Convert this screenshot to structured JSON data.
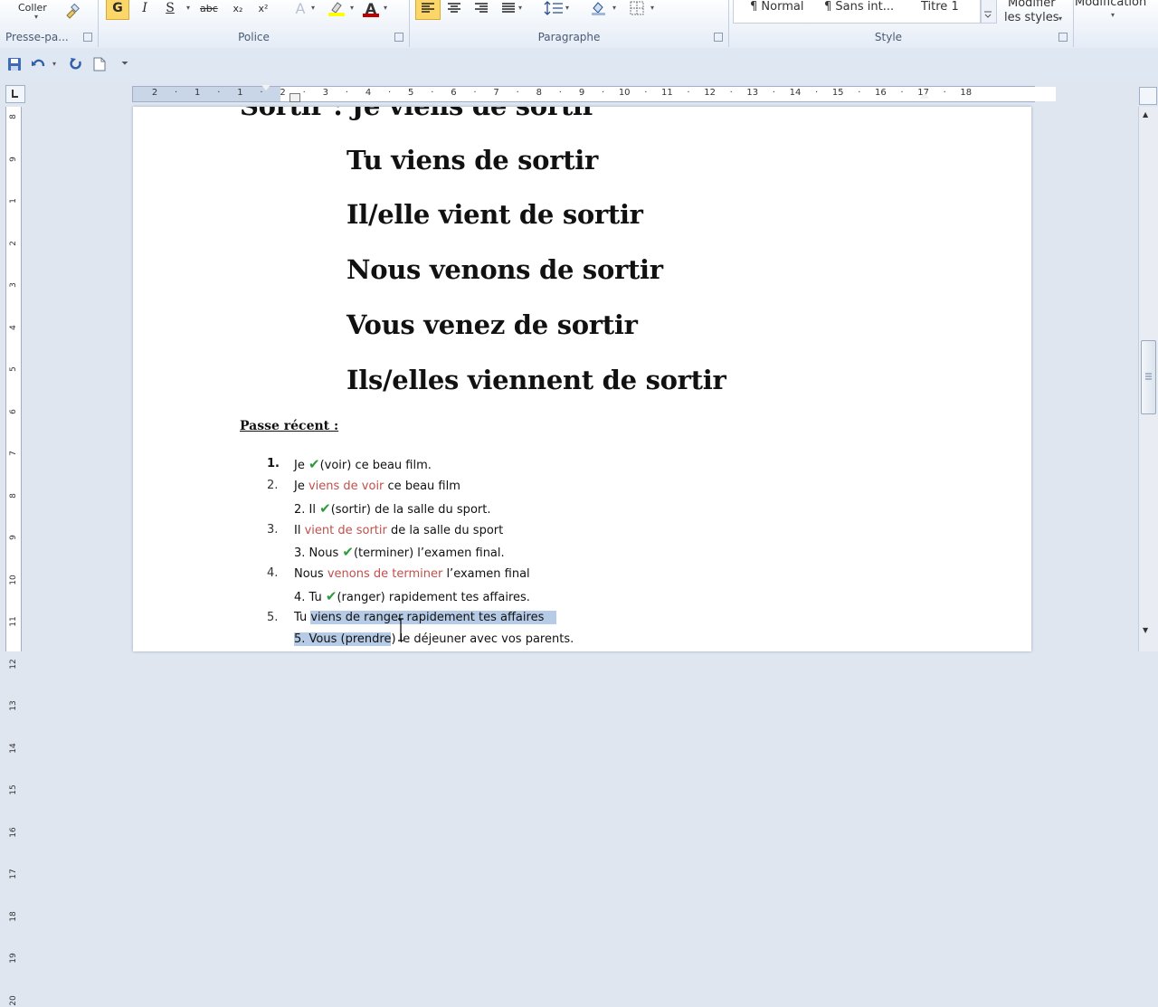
{
  "ribbon": {
    "clipboard": {
      "paste_label": "Coller",
      "group_label": "Presse-pa..."
    },
    "font": {
      "group_label": "Police",
      "bold": "G",
      "italic": "I",
      "strike": "S",
      "strikethrough_label": "abc",
      "subscript": "x₂",
      "superscript": "x²"
    },
    "paragraph": {
      "group_label": "Paragraphe"
    },
    "styles": {
      "group_label": "Style",
      "items": [
        "¶ Normal",
        "¶ Sans int...",
        "Titre 1"
      ],
      "modify_label_1": "Modifier",
      "modify_label_2": "les styles"
    },
    "editing": {
      "label": "Modification"
    }
  },
  "ruler": {
    "h_numbers": [
      "2",
      "1",
      "1",
      "2",
      "3",
      "4",
      "5",
      "6",
      "7",
      "8",
      "9",
      "10",
      "11",
      "12",
      "13",
      "14",
      "15",
      "16",
      "17",
      "18"
    ],
    "v_numbers": [
      "8",
      "9",
      "1",
      "2",
      "3",
      "4",
      "5",
      "6",
      "7",
      "8",
      "9",
      "10",
      "11",
      "12",
      "13",
      "14",
      "15",
      "16",
      "17",
      "18",
      "19",
      "20"
    ]
  },
  "document": {
    "conjugation": [
      "Sortir : Je  viens de sortir",
      "Tu viens de sortir",
      "Il/elle vient de sortir",
      "Nous venons de sortir",
      "Vous venez de sortir",
      "Ils/elles viennent de sortir"
    ],
    "heading": "Passe récent :",
    "exercises": {
      "q1": {
        "num": "1.",
        "before": "Je",
        "after": "(voir) ce beau film."
      },
      "a1": {
        "num": "2.",
        "before": "Je ",
        "red": "viens de voir",
        "after": " ce beau film"
      },
      "q2": {
        "before": "2. Il",
        "after": "(sortir) de la salle du sport."
      },
      "a2": {
        "num": "3.",
        "before": "Il ",
        "red": "vient de sortir",
        "after": " de la salle du sport"
      },
      "q3": {
        "before": "3. Nous",
        "after": "(terminer) l’examen final."
      },
      "a3": {
        "num": "4.",
        "before": "Nous ",
        "red": "venons de terminer",
        "after": " l’examen final"
      },
      "q4": {
        "before": "4. Tu",
        "after": "(ranger) rapidement tes affaires."
      },
      "a4": {
        "num": "5.",
        "before": "Tu ",
        "hl": "viens de ranger  rapidement tes affaires"
      },
      "q5": {
        "hl": "5. Vous (prendre",
        "after": ") le déjeuner avec vos parents."
      }
    }
  },
  "colors": {
    "answer_red": "#c0504d",
    "check_green": "#2e9a3a",
    "selection": "#b6cbe6"
  }
}
